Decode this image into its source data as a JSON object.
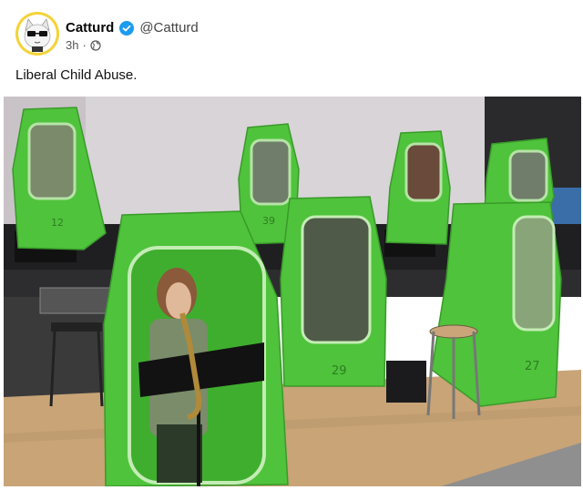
{
  "post": {
    "author_name": "Catturd",
    "handle": "@Catturd",
    "time": "3h",
    "separator": "·",
    "text": "Liberal Child Abuse."
  },
  "photo": {
    "tent_numbers": [
      "12",
      "39",
      "29",
      "27"
    ]
  },
  "colors": {
    "verified_blue": "#1d9bf0",
    "avatar_bg": "#f3d33b",
    "tent_green": "#4fc33b"
  },
  "icons": {
    "audience": "globe-icon",
    "verified": "verified-badge-icon"
  }
}
